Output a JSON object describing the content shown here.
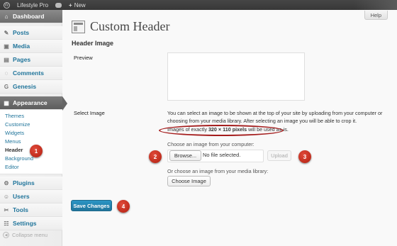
{
  "adminbar": {
    "site_name": "Lifestyle Pro",
    "new_label": "New",
    "plus": "+"
  },
  "sidebar": {
    "items": [
      {
        "label": "Dashboard",
        "icon": "home-icon"
      },
      {
        "label": "Posts",
        "icon": "pin-icon"
      },
      {
        "label": "Media",
        "icon": "media-icon"
      },
      {
        "label": "Pages",
        "icon": "page-icon"
      },
      {
        "label": "Comments",
        "icon": "comment-icon"
      },
      {
        "label": "Genesis",
        "icon": "genesis-icon"
      },
      {
        "label": "Appearance",
        "icon": "appearance-icon"
      },
      {
        "label": "Plugins",
        "icon": "plugin-icon"
      },
      {
        "label": "Users",
        "icon": "users-icon"
      },
      {
        "label": "Tools",
        "icon": "tools-icon"
      },
      {
        "label": "Settings",
        "icon": "settings-icon"
      }
    ],
    "submenu": [
      "Themes",
      "Customize",
      "Widgets",
      "Menus",
      "Header",
      "Background",
      "Editor"
    ],
    "collapse_label": "Collapse menu"
  },
  "main": {
    "help_label": "Help",
    "page_title": "Custom Header",
    "section_title": "Header Image",
    "preview_label": "Preview",
    "select_label": "Select Image",
    "description_line1": "You can select an image to be shown at the top of your site by uploading from your computer or",
    "description_line2": "choosing from your media library. After selecting an image you will be able to crop it.",
    "size_prefix": "Images of exactly ",
    "size_value": "320 × 110 pixels",
    "size_suffix": " will be used as-is.",
    "choose_computer_label": "Choose an image from your computer:",
    "browse_label": "Browse...",
    "file_status": "No file selected.",
    "upload_label": "Upload",
    "choose_library_label": "Or choose an image from your media library:",
    "choose_image_label": "Choose Image",
    "save_label": "Save Changes"
  },
  "annotations": {
    "m1": "1",
    "m2": "2",
    "m3": "3",
    "m4": "4",
    "color": "#b21f10"
  }
}
